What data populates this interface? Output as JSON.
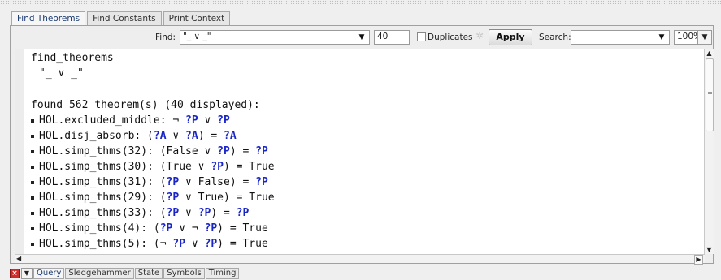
{
  "tabs": [
    {
      "label": "Find Theorems",
      "active": true
    },
    {
      "label": "Find Constants",
      "active": false
    },
    {
      "label": "Print Context",
      "active": false
    }
  ],
  "toolbar": {
    "find_label": "Find:",
    "find_value": "\"_ ∨ _\"",
    "limit_value": "40",
    "duplicates_label": "Duplicates",
    "duplicates_checked": false,
    "apply_label": "Apply",
    "search_label": "Search:",
    "search_value": "",
    "zoom_value": "100%"
  },
  "output": {
    "header": "find_theorems",
    "query": "\"_ ∨ _\"",
    "summary": "found 562 theorem(s) (40 displayed):",
    "theorems": [
      {
        "name": "HOL.excluded_middle:",
        "segments": [
          {
            "t": " ¬ "
          },
          {
            "t": "?P",
            "v": true
          },
          {
            "t": " ∨ "
          },
          {
            "t": "?P",
            "v": true
          }
        ]
      },
      {
        "name": "HOL.disj_absorb:",
        "segments": [
          {
            "t": " ("
          },
          {
            "t": "?A",
            "v": true
          },
          {
            "t": " ∨ "
          },
          {
            "t": "?A",
            "v": true
          },
          {
            "t": ") = "
          },
          {
            "t": "?A",
            "v": true
          }
        ]
      },
      {
        "name": "HOL.simp_thms(32):",
        "segments": [
          {
            "t": " (False ∨ "
          },
          {
            "t": "?P",
            "v": true
          },
          {
            "t": ") = "
          },
          {
            "t": "?P",
            "v": true
          }
        ]
      },
      {
        "name": "HOL.simp_thms(30):",
        "segments": [
          {
            "t": " (True ∨ "
          },
          {
            "t": "?P",
            "v": true
          },
          {
            "t": ") = True"
          }
        ]
      },
      {
        "name": "HOL.simp_thms(31):",
        "segments": [
          {
            "t": " ("
          },
          {
            "t": "?P",
            "v": true
          },
          {
            "t": " ∨ False) = "
          },
          {
            "t": "?P",
            "v": true
          }
        ]
      },
      {
        "name": "HOL.simp_thms(29):",
        "segments": [
          {
            "t": " ("
          },
          {
            "t": "?P",
            "v": true
          },
          {
            "t": " ∨ True) = True"
          }
        ]
      },
      {
        "name": "HOL.simp_thms(33):",
        "segments": [
          {
            "t": " ("
          },
          {
            "t": "?P",
            "v": true
          },
          {
            "t": " ∨ "
          },
          {
            "t": "?P",
            "v": true
          },
          {
            "t": ") = "
          },
          {
            "t": "?P",
            "v": true
          }
        ]
      },
      {
        "name": "HOL.simp_thms(4):",
        "segments": [
          {
            "t": " ("
          },
          {
            "t": "?P",
            "v": true
          },
          {
            "t": " ∨ ¬ "
          },
          {
            "t": "?P",
            "v": true
          },
          {
            "t": ") = True"
          }
        ]
      },
      {
        "name": "HOL.simp_thms(5):",
        "segments": [
          {
            "t": " (¬ "
          },
          {
            "t": "?P",
            "v": true
          },
          {
            "t": " ∨ "
          },
          {
            "t": "?P",
            "v": true
          },
          {
            "t": ") = True"
          }
        ]
      }
    ]
  },
  "bottom_tabs": [
    {
      "label": "Query",
      "active": true
    },
    {
      "label": "Sledgehammer",
      "active": false
    },
    {
      "label": "State",
      "active": false
    },
    {
      "label": "Symbols",
      "active": false
    },
    {
      "label": "Timing",
      "active": false
    }
  ],
  "icons": {
    "close": "close-icon",
    "menu": "chevron-down-icon",
    "spinner": "spinner-icon"
  },
  "colors": {
    "keyword": "#1b5d8e",
    "variable": "#1a25c8",
    "close_button": "#cc2b2b"
  }
}
